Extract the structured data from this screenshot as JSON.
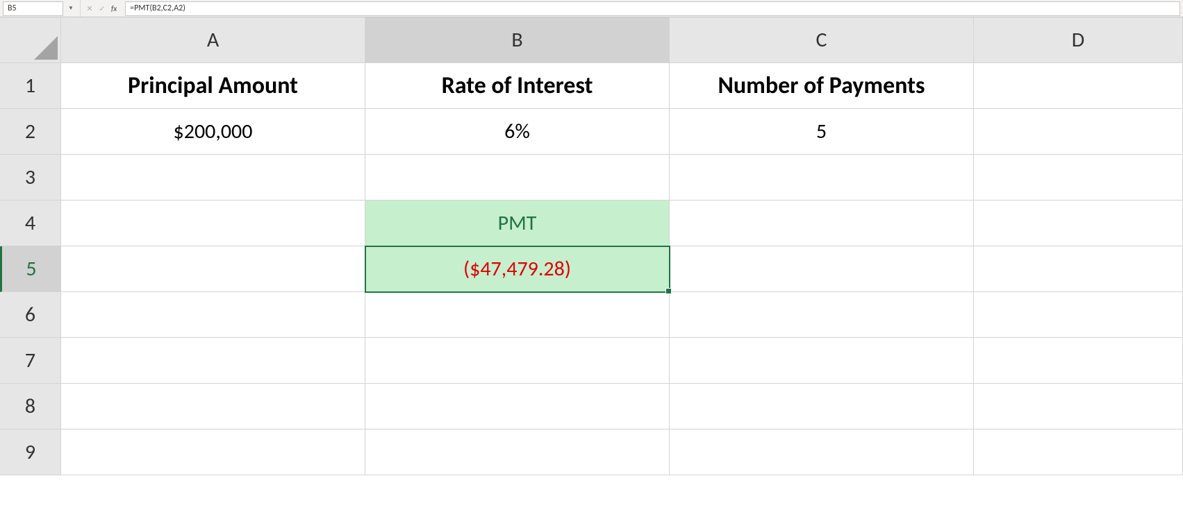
{
  "formula_bar": {
    "name_box": "B5",
    "formula": "=PMT(B2,C2,A2)",
    "fx_label": "fx",
    "cancel_glyph": "✕",
    "enter_glyph": "✓"
  },
  "columns": [
    "A",
    "B",
    "C",
    "D"
  ],
  "rows": [
    "1",
    "2",
    "3",
    "4",
    "5",
    "6",
    "7",
    "8",
    "9"
  ],
  "cells": {
    "A1": "Principal Amount",
    "B1": "Rate of Interest",
    "C1": "Number of Payments",
    "A2": "$200,000",
    "B2": "6%",
    "C2": "5",
    "B4": "PMT",
    "B5": "($47,479.28)"
  },
  "active_cell": "B5"
}
